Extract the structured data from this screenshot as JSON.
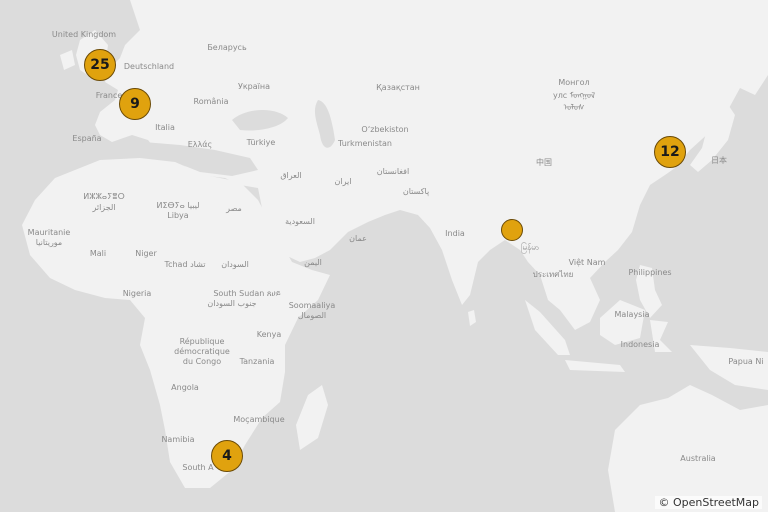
{
  "attribution": "© OpenStreetMap",
  "labels": [
    {
      "id": "uk",
      "text": "United Kingdom"
    },
    {
      "id": "belarus",
      "text": "Беларусь"
    },
    {
      "id": "deutschland",
      "text": "Deutschland"
    },
    {
      "id": "ukraina",
      "text": "Україна"
    },
    {
      "id": "kazakhstan",
      "text": "Қазақстан"
    },
    {
      "id": "mongol1",
      "text": "Монгол"
    },
    {
      "id": "mongol2",
      "text": "улс ᠮᠣᠩᠭᠣᠯ"
    },
    {
      "id": "mongol3",
      "text": "ᠤᠯᠤᠰ"
    },
    {
      "id": "france",
      "text": "France"
    },
    {
      "id": "romania",
      "text": "România"
    },
    {
      "id": "italia",
      "text": "Italia"
    },
    {
      "id": "espana",
      "text": "España"
    },
    {
      "id": "ellas",
      "text": "Ελλάς"
    },
    {
      "id": "turkiye",
      "text": "Türkiye"
    },
    {
      "id": "uzbekiston",
      "text": "O‘zbekiston"
    },
    {
      "id": "turkmenistan",
      "text": "Turkmenistan"
    },
    {
      "id": "china",
      "text": "中国"
    },
    {
      "id": "japan",
      "text": "日本"
    },
    {
      "id": "iraq",
      "text": "العراق"
    },
    {
      "id": "iran",
      "text": "ایران"
    },
    {
      "id": "afghanistan",
      "text": "افغانستان"
    },
    {
      "id": "pakistan",
      "text": "پاکستان"
    },
    {
      "id": "algeria1",
      "text": "ⵍⵣⵣⴰⵢⴻⵔ"
    },
    {
      "id": "algeria2",
      "text": "الجزائر"
    },
    {
      "id": "libya1",
      "text": "ⵍⵉⴱⵢⴰ ليبيا"
    },
    {
      "id": "libya2",
      "text": "Libya"
    },
    {
      "id": "egypt",
      "text": "مصر"
    },
    {
      "id": "saudi",
      "text": "السعودية"
    },
    {
      "id": "oman",
      "text": "عمان"
    },
    {
      "id": "india",
      "text": "India"
    },
    {
      "id": "myanmar",
      "text": "မြန်မာ"
    },
    {
      "id": "mauritania1",
      "text": "Mauritanie"
    },
    {
      "id": "mauritania2",
      "text": "موريتانيا"
    },
    {
      "id": "mali",
      "text": "Mali"
    },
    {
      "id": "niger",
      "text": "Niger"
    },
    {
      "id": "tchad",
      "text": "Tchad تشاد"
    },
    {
      "id": "sudan",
      "text": "السودان"
    },
    {
      "id": "yemen",
      "text": "اليمن"
    },
    {
      "id": "vietnam",
      "text": "Việt Nam"
    },
    {
      "id": "thailand",
      "text": "ประเทศไทย"
    },
    {
      "id": "philippines",
      "text": "Philippines"
    },
    {
      "id": "nigeria",
      "text": "Nigeria"
    },
    {
      "id": "southsudan1",
      "text": "South Sudan ጸሀይ"
    },
    {
      "id": "southsudan2",
      "text": "جنوب السودان"
    },
    {
      "id": "somalia1",
      "text": "Soomaaliya"
    },
    {
      "id": "somalia2",
      "text": "الصومال"
    },
    {
      "id": "kenya",
      "text": "Kenya"
    },
    {
      "id": "malaysia",
      "text": "Malaysia"
    },
    {
      "id": "rdc1",
      "text": "République"
    },
    {
      "id": "rdc2",
      "text": "démocratique"
    },
    {
      "id": "rdc3",
      "text": "du Congo"
    },
    {
      "id": "tanzania",
      "text": "Tanzania"
    },
    {
      "id": "indonesia",
      "text": "Indonesia"
    },
    {
      "id": "papua",
      "text": "Papua Ni"
    },
    {
      "id": "angola",
      "text": "Angola"
    },
    {
      "id": "mocambique",
      "text": "Moçambique"
    },
    {
      "id": "namibia",
      "text": "Namibia"
    },
    {
      "id": "southafrica",
      "text": "South A"
    },
    {
      "id": "australia",
      "text": "Australia"
    }
  ],
  "clusters": [
    {
      "id": "uk-cluster",
      "count": "25"
    },
    {
      "id": "france-cluster",
      "count": "9"
    },
    {
      "id": "japan-cluster",
      "count": "12"
    },
    {
      "id": "southafrica-cluster",
      "count": "4"
    },
    {
      "id": "bangladesh-marker",
      "count": ""
    }
  ],
  "colors": {
    "land": "#f2f2f2",
    "water": "#dcdcdc",
    "cluster_fill": "#e0a20e",
    "cluster_border": "#6b4a05"
  }
}
